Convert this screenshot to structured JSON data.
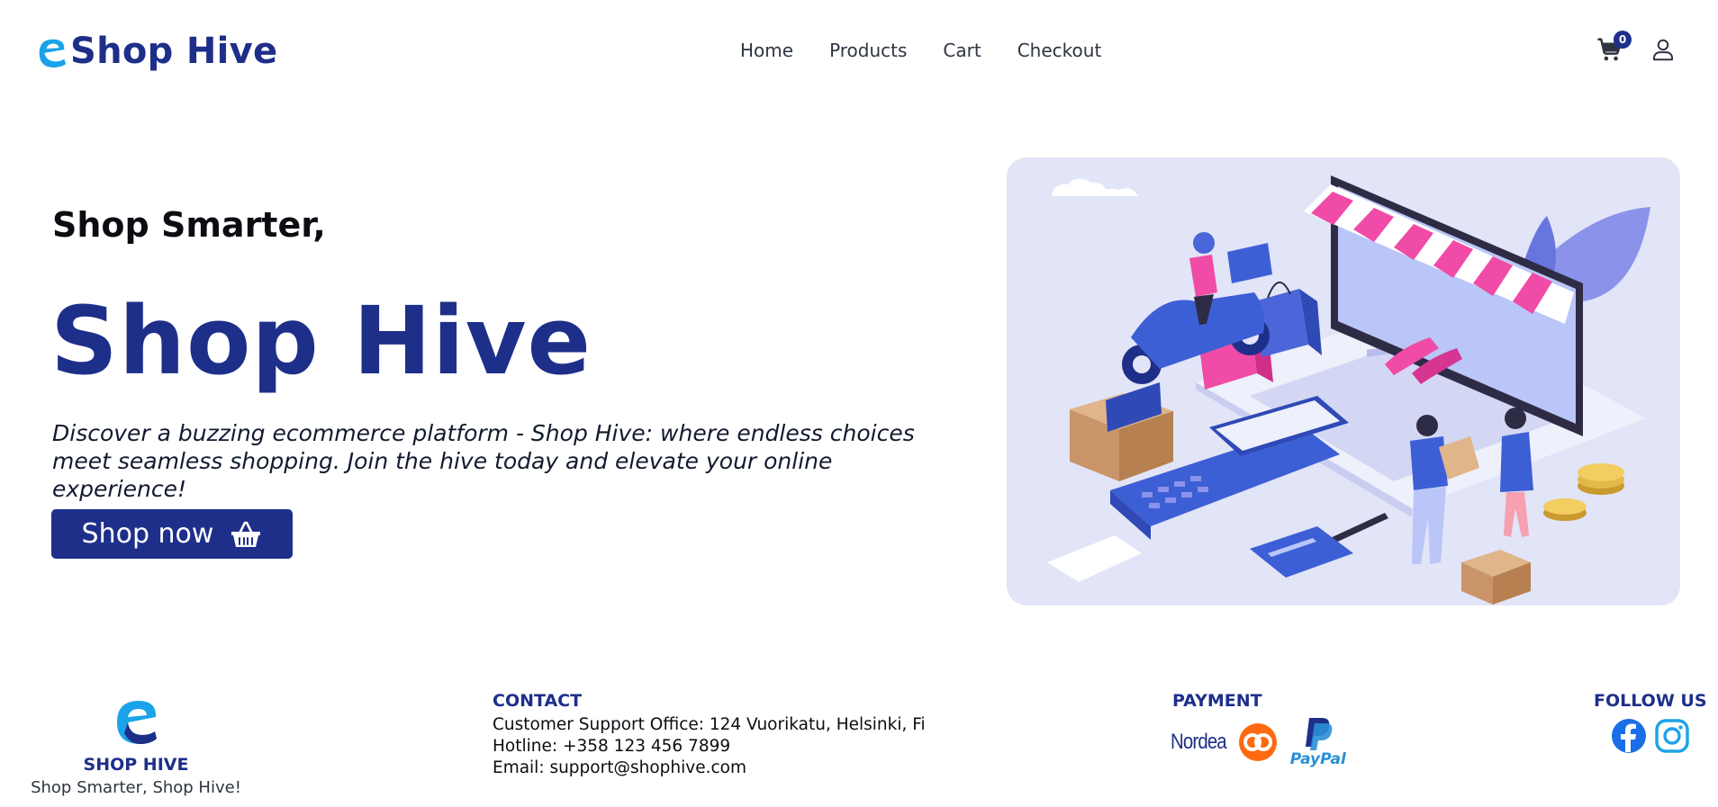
{
  "header": {
    "brand": "Shop Hive",
    "nav": [
      "Home",
      "Products",
      "Cart",
      "Checkout"
    ],
    "cart_count": "0"
  },
  "hero": {
    "subtitle": "Shop Smarter,",
    "title": "Shop Hive",
    "description": "Discover a buzzing ecommerce platform - Shop Hive: where endless choices meet seamless shopping. Join the hive today and elevate your online experience!",
    "cta_label": "Shop now"
  },
  "footer": {
    "brand_name": "SHOP HIVE",
    "tagline": "Shop Smarter, Shop Hive!",
    "contact": {
      "heading": "CONTACT",
      "office": "Customer Support Office: 124 Vuorikatu, Helsinki, Fi",
      "hotline": "Hotline: +358 123 456 7899",
      "email": "Email: support@shophive.com"
    },
    "payment": {
      "heading": "PAYMENT",
      "nordea": "Nordea",
      "paypal": "PayPal"
    },
    "follow": {
      "heading": "FOLLOW US"
    }
  },
  "colors": {
    "brand": "#1e2f8a",
    "hero_bg": "#e2e4f7",
    "accent_pink": "#f04ba6"
  },
  "icons": [
    "brand-logo-icon",
    "cart-icon",
    "user-icon",
    "basket-icon",
    "op-icon",
    "paypal-icon",
    "facebook-icon",
    "instagram-icon"
  ]
}
